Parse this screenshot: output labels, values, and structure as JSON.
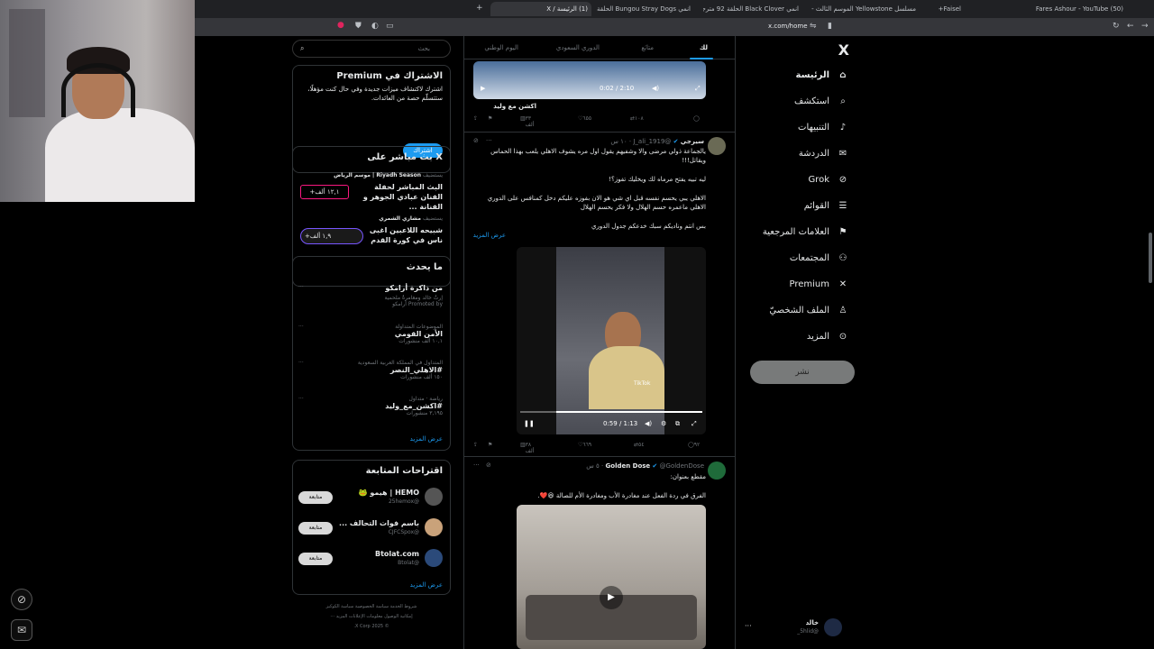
{
  "browser": {
    "tabs": [
      {
        "label": "(50) Fares Ashour - YouTube",
        "active": false
      },
      {
        "label": "Faisel+",
        "active": false
      },
      {
        "label": "مسلسل Yellowstone الموسم الثالث -",
        "active": false
      },
      {
        "label": "انمي Black Clover الحلقة 92 مترجمة",
        "active": false
      },
      {
        "label": "انمي Bungou Stray Dogs الحلقة 3 مت",
        "active": false
      },
      {
        "label": "(1) الرئيسة / X",
        "active": true
      }
    ],
    "new_tab": "+",
    "url": "x.com/home"
  },
  "nav": {
    "logo": "X",
    "items": [
      {
        "label": "الرئيسة",
        "icon": "home-icon",
        "glyph": "⌂"
      },
      {
        "label": "استكشف",
        "icon": "search-icon",
        "glyph": "⌕"
      },
      {
        "label": "التنبيهات",
        "icon": "bell-icon",
        "glyph": "♪"
      },
      {
        "label": "الدردشة",
        "icon": "mail-icon",
        "glyph": "✉"
      },
      {
        "label": "Grok",
        "icon": "grok-icon",
        "glyph": "⊘"
      },
      {
        "label": "القوائم",
        "icon": "list-icon",
        "glyph": "☰"
      },
      {
        "label": "العلامات المرجعية",
        "icon": "bookmark-icon",
        "glyph": "⚑"
      },
      {
        "label": "المجتمعات",
        "icon": "communities-icon",
        "glyph": "⚇"
      },
      {
        "label": "Premium",
        "icon": "x-premium-icon",
        "glyph": "✕"
      },
      {
        "label": "الملف الشخصيّ",
        "icon": "profile-icon",
        "glyph": "♙"
      },
      {
        "label": "المزيد",
        "icon": "more-circle-icon",
        "glyph": "⊙"
      }
    ],
    "post_button": "نشر",
    "account": {
      "name": "خالد",
      "handle": "@5hlid_",
      "more": "···"
    }
  },
  "feed": {
    "tabs": [
      "لك",
      "متابَع",
      "الدوري السعودي",
      "اليوم الوطني"
    ],
    "top_video": {
      "time": "0:02 / 2:10"
    },
    "top_tweet_footer": "اكشن مع وليد",
    "top_actions": {
      "replies": "",
      "reposts": "١٠٨",
      "likes": "٦٥٥",
      "views": "٣٣ ألف"
    },
    "tweet1": {
      "name": "سيرجي",
      "handle": "@J_ali_1919",
      "time": "١٠ س",
      "text1": "يالجماعة ذولي مرضى والا وشفيهم يقول اول مره يشوف الاهلي يلعب بهذا الحماس ويقاتل!!!",
      "text2": "ليه تبيه يفتح مرماه لك ويخليك تفوز؟!",
      "text3": "الاهلي يبي يحسم نفسه قبل اي شي هو الان بفوزه عليكم دخل كمنافس على الدوري الاهلي ماعمره حسم الهلال ولا فكر يحسم الهلال",
      "text4": "بس انتم وناديكم سبك خدعكم جدول الدوري",
      "show_more": "عرض المزيد",
      "video_time": "0:59 / 1:13",
      "tiktok": "TikTok",
      "actions": {
        "replies": "٩٢",
        "reposts": "٥٤",
        "likes": "٦٦٩",
        "views": "٣٨ ألف"
      }
    },
    "tweet2": {
      "name": "Golden Dose",
      "handle": "@GoldenDose",
      "time": "٥ س",
      "text1": "مقطع بعنوان:",
      "text2": "الفرق في ردة الفعل عند مغادرة الأب ومغادرة الأم للصالة 😆❤️."
    }
  },
  "right": {
    "search_placeholder": "بحث",
    "premium": {
      "title": "الاشتراك في Premium",
      "text": "اشترك لاكتشاف ميزات جديدة وفي حال كنت مؤهلًا، ستتسلّم حصة من العائدات.",
      "button": "اشتراك"
    },
    "live": {
      "title": "X بث مباشر على",
      "items": [
        {
          "host": "Riyadh Season | موسم الرياض",
          "prefix": "يستضيف",
          "title": "البث المباشر لحفلة الفنان عبادي الجوهر و الفنانة ...",
          "count": "١٢,١ ألف+"
        },
        {
          "host": "مشاري الشمري",
          "prefix": "يستضيف",
          "title": "شبيحه اللاعبين اغبى ناس في كورة القدم",
          "count": "١,٩ ألف+"
        }
      ]
    },
    "trends": {
      "title": "ما يحدث",
      "items": [
        {
          "context": "",
          "name": "من ذاكرة أرامكو",
          "sub": "إرثٌ خالد ومغامرةٌ ملحمية",
          "meta": "Promoted by أرامكو"
        },
        {
          "context": "الموضوعات المتداولة",
          "name": "الأمن القومي",
          "sub": "",
          "meta": "١٠,١ ألف منشورات"
        },
        {
          "context": "المتداول في المملكة العربية السعودية",
          "name": "#الاهلي_النصر",
          "sub": "",
          "meta": "١٥٠ ألف منشورات"
        },
        {
          "context": "رياضة · متداول",
          "name": "#اكشن_مع_وليد",
          "sub": "",
          "meta": "٣,١٩٥ منشورات"
        }
      ],
      "show_more": "عرض المزيد"
    },
    "who_to_follow": {
      "title": "اقتراحات المتابعة",
      "items": [
        {
          "name": "HEMO | هيمو 🐸",
          "handle": "@25hemox",
          "button": "متابعة"
        },
        {
          "name": "باسم فوات التحالف ...",
          "handle": "@CJFCSpox",
          "button": "متابعة"
        },
        {
          "name": "Btolat.com",
          "handle": "@Btolat",
          "button": "متابعة"
        }
      ],
      "show_more": "عرض المزيد"
    },
    "footer": {
      "line1": "شروط الخدمة   سياسة الخصوصية   سياسة الكوكيز",
      "line2": "إمكانية الوصول   معلومات الإعلانات   المزيد ···",
      "line3": "© 2025 X Corp."
    }
  },
  "colors": {
    "accent": "#1d9bf0",
    "background": "#000000",
    "border": "#2f3336",
    "muted": "#71767b"
  }
}
